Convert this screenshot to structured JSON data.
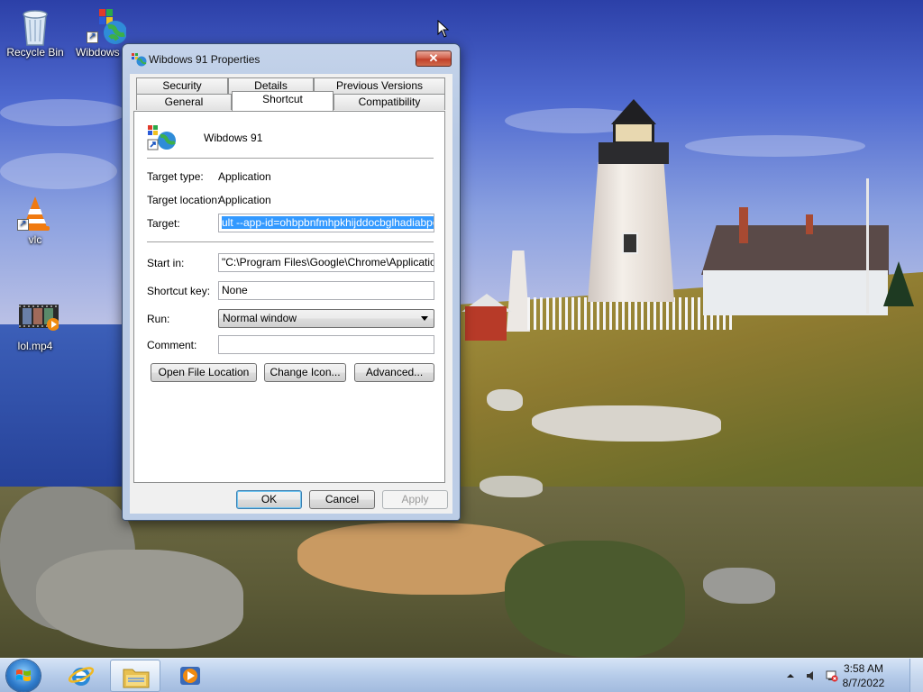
{
  "desktop": {
    "icons": [
      {
        "label": "Recycle Bin"
      },
      {
        "label": "Wibdows 91"
      },
      {
        "label": "vlc"
      },
      {
        "label": "lol.mp4"
      }
    ]
  },
  "dialog": {
    "title": "Wibdows 91 Properties",
    "close_glyph": "✕",
    "tabs_row1": [
      "Security",
      "Details",
      "Previous Versions"
    ],
    "tabs_row2": [
      "General",
      "Shortcut",
      "Compatibility"
    ],
    "active_tab": "Shortcut",
    "shortcut": {
      "name": "Wibdows 91",
      "target_type_label": "Target type:",
      "target_type_value": "Application",
      "target_location_label": "Target location:",
      "target_location_value": "Application",
      "target_label": "Target:",
      "target_value": "ult --app-id=ohbpbnfmhpkhijddocbglhadiabpoacm",
      "start_in_label": "Start in:",
      "start_in_value": "\"C:\\Program Files\\Google\\Chrome\\Application\"",
      "shortcut_key_label": "Shortcut key:",
      "shortcut_key_value": "None",
      "run_label": "Run:",
      "run_value": "Normal window",
      "comment_label": "Comment:",
      "comment_value": "",
      "open_file_location": "Open File Location",
      "change_icon": "Change Icon...",
      "advanced": "Advanced..."
    },
    "buttons": {
      "ok": "OK",
      "cancel": "Cancel",
      "apply": "Apply"
    }
  },
  "taskbar": {
    "time": "3:58 AM",
    "date": "8/7/2022"
  },
  "colors": {
    "selection": "#3399ff",
    "taskbar": "#b0c8e8",
    "close_button": "#c0402a"
  }
}
